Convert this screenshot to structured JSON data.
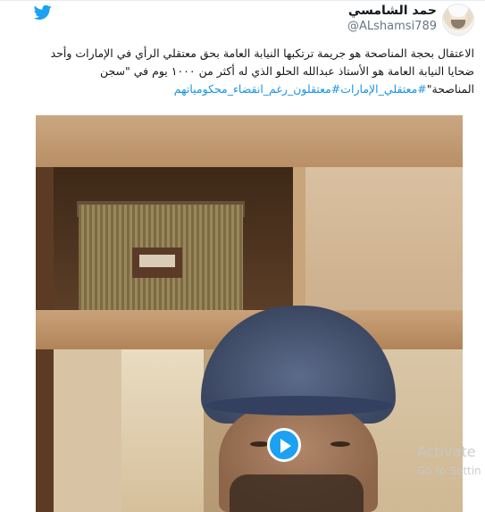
{
  "header": {
    "display_name": "حمد الشامسي",
    "handle": "@ALshamsi789",
    "icons": {
      "logo": "twitter-bird-icon",
      "avatar": "user-avatar"
    },
    "colors": {
      "brand": "#1da1f2"
    }
  },
  "tweet": {
    "lines": [
      "الاعتقال بحجة المناصحة هو جريمة ترتكبها النيابة العامة بحق معتقلي الرأي في الإمارات وأحد",
      "ضحايا النيابة العامة هو الأستاذ عبدالله الحلو الذي له أكثر من ١٠٠٠ يوم في \"سجن",
      "المناصحة\""
    ],
    "hashtags": "#معتقلي_الإمارات#معتقلون_رغم_انقضاء_محكومياتهم",
    "link_color": "#1b95e0"
  },
  "media": {
    "type": "video",
    "play_icon": "play-icon",
    "overlay_line1": "Activate",
    "overlay_line2": "Go to Settin"
  }
}
